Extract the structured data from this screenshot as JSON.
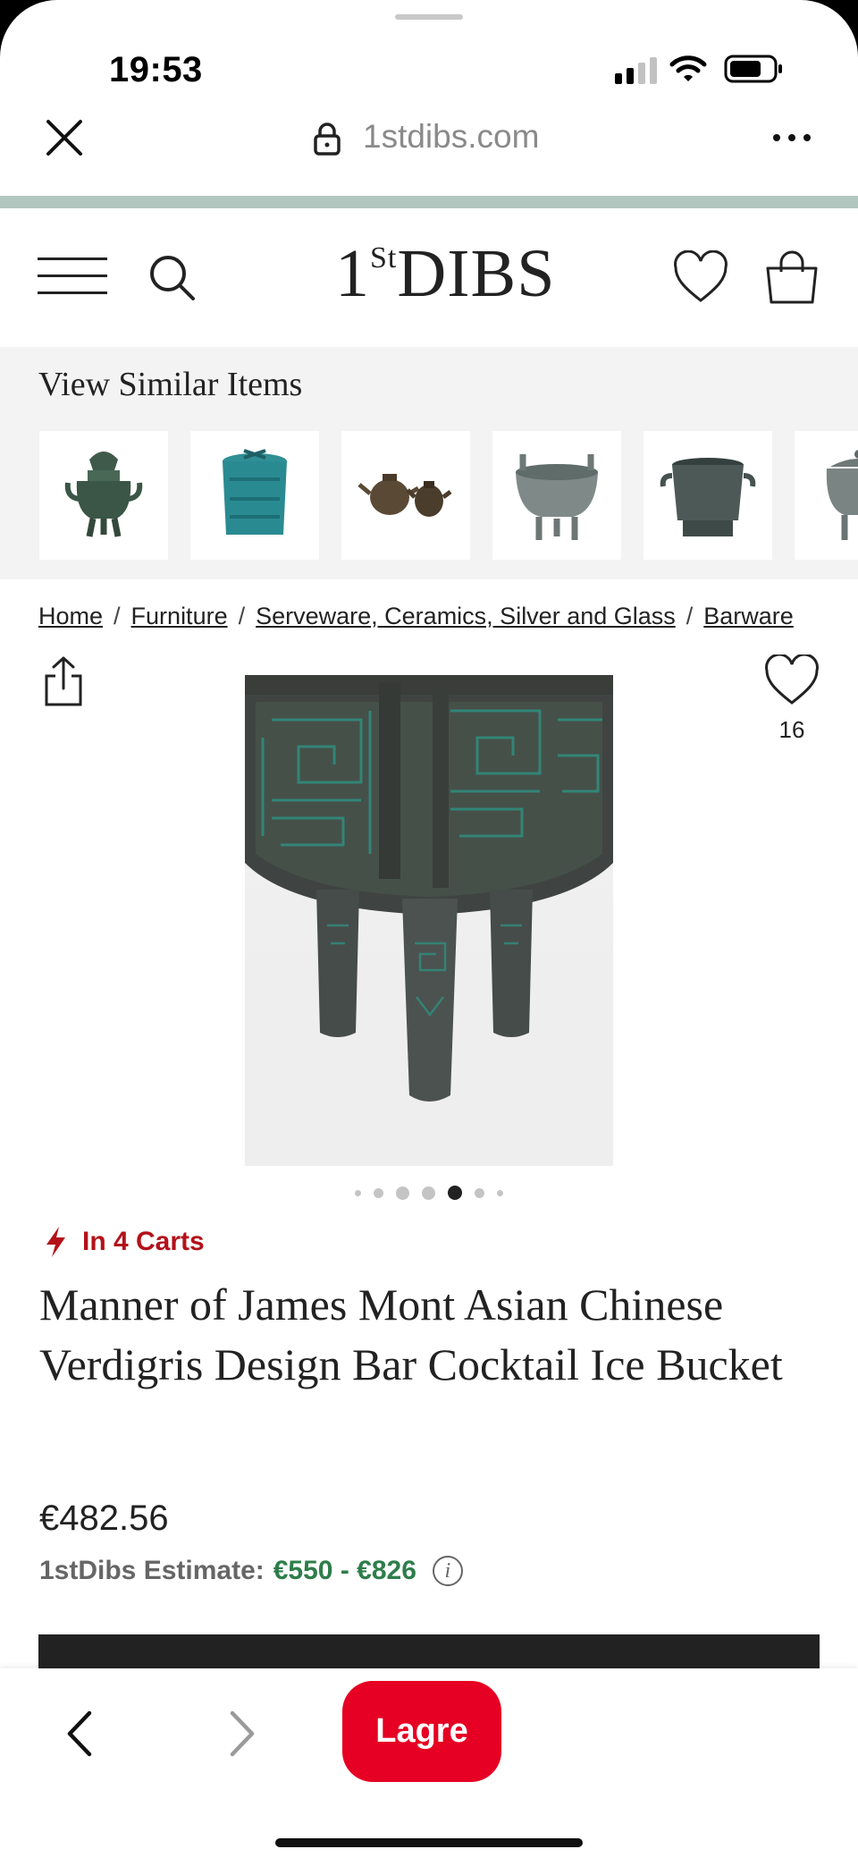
{
  "status_bar": {
    "time": "19:53"
  },
  "browser": {
    "url": "1stdibs.com"
  },
  "site": {
    "logo_main": "DIBS",
    "logo_one": "1",
    "logo_st": "St"
  },
  "similar": {
    "title": "View Similar Items",
    "thumbs": [
      "incense-burner",
      "verdigris-bucket",
      "teapots",
      "tripod-bowl",
      "bronze-urn",
      "lidded-vessel"
    ]
  },
  "breadcrumbs": [
    {
      "label": "Home"
    },
    {
      "label": "Furniture"
    },
    {
      "label": "Serveware, Ceramics, Silver and Glass"
    },
    {
      "label": "Barware"
    }
  ],
  "product": {
    "favorite_count": "16",
    "in_carts": "In 4 Carts",
    "title": "Manner of James Mont Asian Chinese Verdigris Design Bar Cocktail Ice Bucket",
    "price": "€482.56",
    "estimate_label": "1stDibs Estimate:",
    "estimate_range": "€550 - €826",
    "info_glyph": "i",
    "image_count": 7,
    "current_image": 5
  },
  "bottom_bar": {
    "save_label": "Lagre"
  },
  "colors": {
    "accent_red": "#b3121a",
    "save_red": "#e60023",
    "estimate_green": "#2e7d4a",
    "teal_strip": "#b2c6c0"
  }
}
